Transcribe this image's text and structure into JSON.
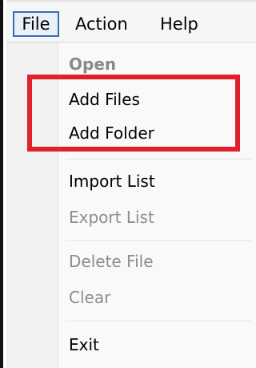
{
  "menubar": {
    "items": [
      {
        "label": "File"
      },
      {
        "label": "Action"
      },
      {
        "label": "Help"
      }
    ]
  },
  "file_menu": {
    "items": [
      {
        "label": "Open",
        "state": "disabled-bold"
      },
      {
        "label": "Add Files",
        "state": "enabled"
      },
      {
        "label": "Add Folder",
        "state": "enabled"
      },
      {
        "label": "Import List",
        "state": "enabled"
      },
      {
        "label": "Export List",
        "state": "disabled"
      },
      {
        "label": "Delete File",
        "state": "disabled"
      },
      {
        "label": "Clear",
        "state": "disabled"
      },
      {
        "label": "Exit",
        "state": "enabled"
      }
    ]
  },
  "annotation": {
    "highlight_color": "#e0202a",
    "highlighted_items": [
      "Add Files",
      "Add Folder"
    ]
  },
  "colors": {
    "active_menu_border": "#3a6fb0",
    "disabled_text": "#8d8d8d"
  }
}
